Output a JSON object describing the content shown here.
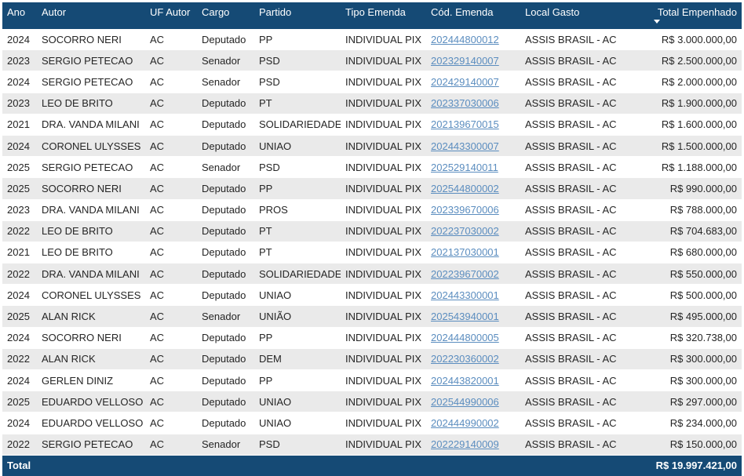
{
  "headers": {
    "ano": "Ano",
    "autor": "Autor",
    "uf": "UF Autor",
    "cargo": "Cargo",
    "partido": "Partido",
    "tipo": "Tipo Emenda",
    "cod": "Cód. Emenda",
    "local": "Local Gasto",
    "total": "Total Empenhado"
  },
  "sort_icon": "sort-descending-icon",
  "rows": [
    [
      "2024",
      "SOCORRO NERI",
      "AC",
      "Deputado",
      "PP",
      "INDIVIDUAL PIX",
      "202444800012",
      "ASSIS BRASIL - AC",
      "R$ 3.000.000,00"
    ],
    [
      "2023",
      "SERGIO PETECAO",
      "AC",
      "Senador",
      "PSD",
      "INDIVIDUAL PIX",
      "202329140007",
      "ASSIS BRASIL - AC",
      "R$ 2.500.000,00"
    ],
    [
      "2024",
      "SERGIO PETECAO",
      "AC",
      "Senador",
      "PSD",
      "INDIVIDUAL PIX",
      "202429140007",
      "ASSIS BRASIL - AC",
      "R$ 2.000.000,00"
    ],
    [
      "2023",
      "LEO DE BRITO",
      "AC",
      "Deputado",
      "PT",
      "INDIVIDUAL PIX",
      "202337030006",
      "ASSIS BRASIL - AC",
      "R$ 1.900.000,00"
    ],
    [
      "2021",
      "DRA. VANDA MILANI",
      "AC",
      "Deputado",
      "SOLIDARIEDADE",
      "INDIVIDUAL PIX",
      "202139670015",
      "ASSIS BRASIL - AC",
      "R$ 1.600.000,00"
    ],
    [
      "2024",
      "CORONEL ULYSSES",
      "AC",
      "Deputado",
      "UNIAO",
      "INDIVIDUAL PIX",
      "202443300007",
      "ASSIS BRASIL - AC",
      "R$ 1.500.000,00"
    ],
    [
      "2025",
      "SERGIO PETECAO",
      "AC",
      "Senador",
      "PSD",
      "INDIVIDUAL PIX",
      "202529140011",
      "ASSIS BRASIL - AC",
      "R$ 1.188.000,00"
    ],
    [
      "2025",
      "SOCORRO NERI",
      "AC",
      "Deputado",
      "PP",
      "INDIVIDUAL PIX",
      "202544800002",
      "ASSIS BRASIL - AC",
      "R$ 990.000,00"
    ],
    [
      "2023",
      "DRA. VANDA MILANI",
      "AC",
      "Deputado",
      "PROS",
      "INDIVIDUAL PIX",
      "202339670006",
      "ASSIS BRASIL - AC",
      "R$ 788.000,00"
    ],
    [
      "2022",
      "LEO DE BRITO",
      "AC",
      "Deputado",
      "PT",
      "INDIVIDUAL PIX",
      "202237030002",
      "ASSIS BRASIL - AC",
      "R$ 704.683,00"
    ],
    [
      "2021",
      "LEO DE BRITO",
      "AC",
      "Deputado",
      "PT",
      "INDIVIDUAL PIX",
      "202137030001",
      "ASSIS BRASIL - AC",
      "R$ 680.000,00"
    ],
    [
      "2022",
      "DRA. VANDA MILANI",
      "AC",
      "Deputado",
      "SOLIDARIEDADE",
      "INDIVIDUAL PIX",
      "202239670002",
      "ASSIS BRASIL - AC",
      "R$ 550.000,00"
    ],
    [
      "2024",
      "CORONEL ULYSSES",
      "AC",
      "Deputado",
      "UNIAO",
      "INDIVIDUAL PIX",
      "202443300001",
      "ASSIS BRASIL - AC",
      "R$ 500.000,00"
    ],
    [
      "2025",
      "ALAN RICK",
      "AC",
      "Senador",
      "UNIÃO",
      "INDIVIDUAL PIX",
      "202543940001",
      "ASSIS BRASIL - AC",
      "R$ 495.000,00"
    ],
    [
      "2024",
      "SOCORRO NERI",
      "AC",
      "Deputado",
      "PP",
      "INDIVIDUAL PIX",
      "202444800005",
      "ASSIS BRASIL - AC",
      "R$ 320.738,00"
    ],
    [
      "2022",
      "ALAN RICK",
      "AC",
      "Deputado",
      "DEM",
      "INDIVIDUAL PIX",
      "202230360002",
      "ASSIS BRASIL - AC",
      "R$ 300.000,00"
    ],
    [
      "2024",
      "GERLEN DINIZ",
      "AC",
      "Deputado",
      "PP",
      "INDIVIDUAL PIX",
      "202443820001",
      "ASSIS BRASIL - AC",
      "R$ 300.000,00"
    ],
    [
      "2025",
      "EDUARDO VELLOSO",
      "AC",
      "Deputado",
      "UNIAO",
      "INDIVIDUAL PIX",
      "202544990006",
      "ASSIS BRASIL - AC",
      "R$ 297.000,00"
    ],
    [
      "2024",
      "EDUARDO VELLOSO",
      "AC",
      "Deputado",
      "UNIAO",
      "INDIVIDUAL PIX",
      "202444990002",
      "ASSIS BRASIL - AC",
      "R$ 234.000,00"
    ],
    [
      "2022",
      "SERGIO PETECAO",
      "AC",
      "Senador",
      "PSD",
      "INDIVIDUAL PIX",
      "202229140009",
      "ASSIS BRASIL - AC",
      "R$ 150.000,00"
    ]
  ],
  "footer": {
    "label": "Total",
    "total": "R$ 19.997.421,00"
  },
  "colors": {
    "header_bg": "#154a75",
    "row_alt_bg": "#eaeaea",
    "link": "#5b8dbf"
  }
}
